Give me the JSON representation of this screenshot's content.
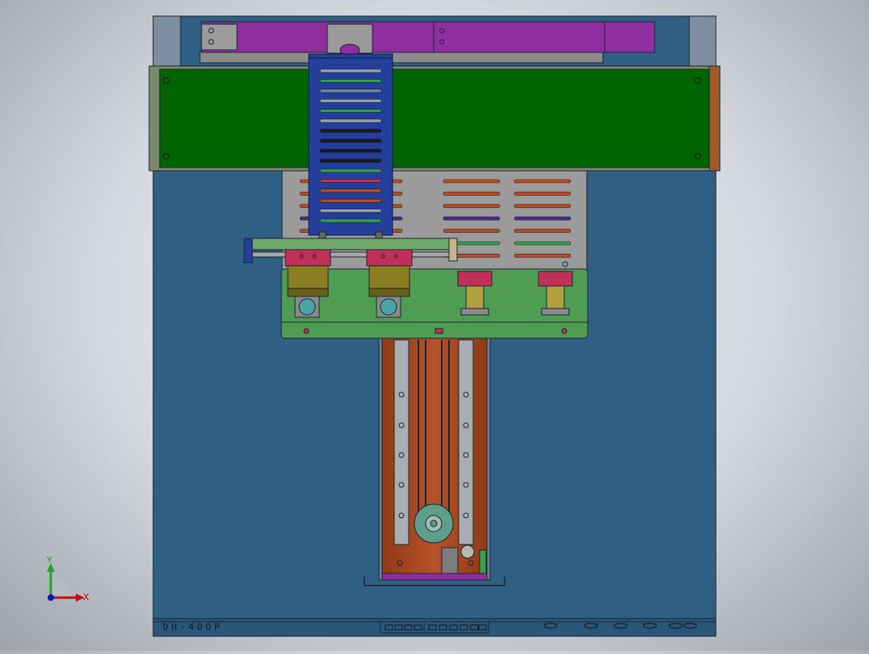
{
  "viewport": {
    "colors": {
      "background_center": "#f2f3f5",
      "background_edge": "#9ea3ac",
      "base_plate": "#2f5f82",
      "top_rail": "#8f2e9f",
      "green_beam": "#006400",
      "blue_module": "#233f9a",
      "grey_panel": "#9b9b9b",
      "light_green_plate": "#4f9d52",
      "copper_slide": "#a3461e",
      "pink_block": "#c0305a",
      "olive_block": "#8a7d22",
      "teal_roller": "#4aa6a6"
    }
  },
  "base_labels": {
    "left_label": "DH-4OOP"
  },
  "triad": {
    "y_label": "Y",
    "x_label": "X",
    "y_color": "#2e9e2e",
    "x_color": "#c01010",
    "z_color": "#1010c0"
  }
}
